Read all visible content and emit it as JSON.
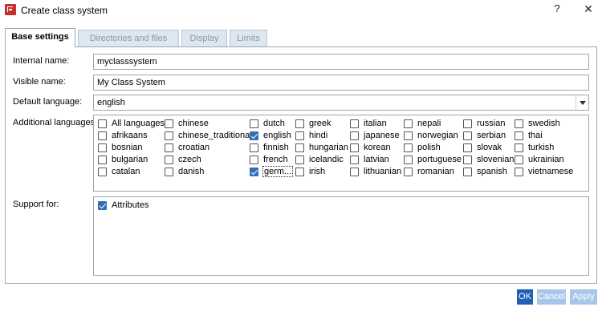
{
  "window": {
    "title": "Create class system",
    "help_glyph": "?",
    "close_glyph": "✕"
  },
  "tabs": [
    {
      "label": "Base settings",
      "active": true
    },
    {
      "label": "Directories and files",
      "active": false
    },
    {
      "label": "Display",
      "active": false
    },
    {
      "label": "Limits",
      "active": false
    }
  ],
  "form": {
    "internal_name_label": "Internal name:",
    "internal_name_value": "myclasssystem",
    "visible_name_label": "Visible name:",
    "visible_name_value": "My Class System",
    "default_language_label": "Default language:",
    "default_language_value": "english",
    "additional_languages_label": "Additional languages:",
    "support_for_label": "Support for:"
  },
  "languages": [
    {
      "label": "All languages",
      "checked": false
    },
    {
      "label": "afrikaans",
      "checked": false
    },
    {
      "label": "bosnian",
      "checked": false
    },
    {
      "label": "bulgarian",
      "checked": false
    },
    {
      "label": "catalan",
      "checked": false
    },
    {
      "label": "chinese",
      "checked": false
    },
    {
      "label": "chinese_traditional",
      "checked": false
    },
    {
      "label": "croatian",
      "checked": false
    },
    {
      "label": "czech",
      "checked": false
    },
    {
      "label": "danish",
      "checked": false
    },
    {
      "label": "dutch",
      "checked": false
    },
    {
      "label": "english",
      "checked": true
    },
    {
      "label": "finnish",
      "checked": false
    },
    {
      "label": "french",
      "checked": false
    },
    {
      "label": "germ...",
      "checked": true,
      "focused": true
    },
    {
      "label": "greek",
      "checked": false
    },
    {
      "label": "hindi",
      "checked": false
    },
    {
      "label": "hungarian",
      "checked": false
    },
    {
      "label": "icelandic",
      "checked": false
    },
    {
      "label": "irish",
      "checked": false
    },
    {
      "label": "italian",
      "checked": false
    },
    {
      "label": "japanese",
      "checked": false
    },
    {
      "label": "korean",
      "checked": false
    },
    {
      "label": "latvian",
      "checked": false
    },
    {
      "label": "lithuanian",
      "checked": false
    },
    {
      "label": "nepali",
      "checked": false
    },
    {
      "label": "norwegian",
      "checked": false
    },
    {
      "label": "polish",
      "checked": false
    },
    {
      "label": "portuguese",
      "checked": false
    },
    {
      "label": "romanian",
      "checked": false
    },
    {
      "label": "russian",
      "checked": false
    },
    {
      "label": "serbian",
      "checked": false
    },
    {
      "label": "slovak",
      "checked": false
    },
    {
      "label": "slovenian",
      "checked": false
    },
    {
      "label": "spanish",
      "checked": false
    },
    {
      "label": "swedish",
      "checked": false
    },
    {
      "label": "thai",
      "checked": false
    },
    {
      "label": "turkish",
      "checked": false
    },
    {
      "label": "ukrainian",
      "checked": false
    },
    {
      "label": "vietnamese",
      "checked": false
    }
  ],
  "support": [
    {
      "label": "Attributes",
      "checked": true
    }
  ],
  "buttons": {
    "ok": "OK",
    "cancel": "Cancel",
    "apply": "Apply"
  }
}
